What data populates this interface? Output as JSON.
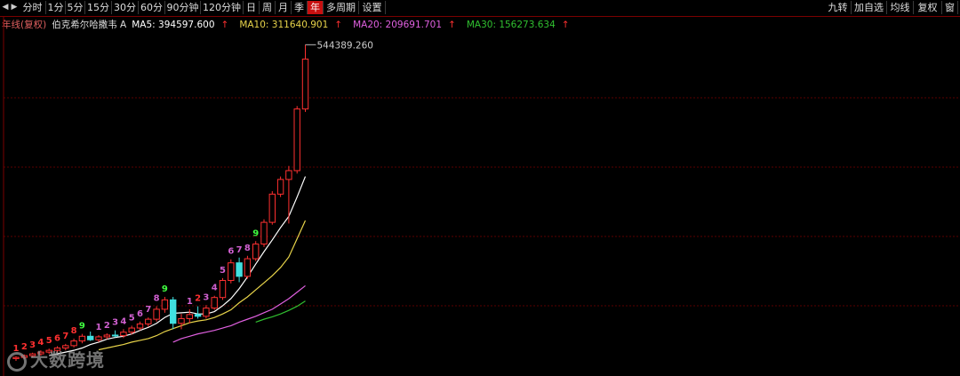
{
  "toolbar": {
    "left_items": [
      "分时",
      "1分",
      "5分",
      "15分",
      "30分",
      "60分",
      "90分钟",
      "120分钟",
      "日",
      "周",
      "月",
      "季",
      "年",
      "多周期",
      "设置"
    ],
    "active_item": "年",
    "right_items": [
      "九转",
      "加自选",
      "均线",
      "复权",
      "窗"
    ]
  },
  "legend": {
    "period": "年线(复权)",
    "name": "伯克希尔哈撒韦 A",
    "ma5": "MA5: 394597.600",
    "ma10": "MA10: 311640.901",
    "ma20": "MA20: 209691.701",
    "ma30": "MA30: 156273.634"
  },
  "price_label_high": "544389.260",
  "watermark": "大数跨境",
  "colors": {
    "up": "#ff3030",
    "down": "#40e0e0",
    "ma5": "#ffffff",
    "ma10": "#e8d44a",
    "ma20": "#e060e0",
    "ma30": "#30c030",
    "grid": "#5a0000",
    "td_purple": "#d060d0",
    "td_red": "#ff3030",
    "td_green": "#40ff40"
  },
  "chart_data": {
    "type": "candlestick",
    "ylim": [
      0,
      560000
    ],
    "candles": [
      {
        "o": 10,
        "h": 14,
        "l": 6,
        "c": 12,
        "d": "up"
      },
      {
        "o": 12,
        "h": 17,
        "l": 9,
        "c": 15,
        "d": "up"
      },
      {
        "o": 15,
        "h": 20,
        "l": 12,
        "c": 18,
        "d": "up"
      },
      {
        "o": 18,
        "h": 24,
        "l": 15,
        "c": 21,
        "d": "up"
      },
      {
        "o": 21,
        "h": 27,
        "l": 18,
        "c": 24,
        "d": "up"
      },
      {
        "o": 24,
        "h": 31,
        "l": 20,
        "c": 28,
        "d": "up"
      },
      {
        "o": 28,
        "h": 35,
        "l": 24,
        "c": 32,
        "d": "up"
      },
      {
        "o": 32,
        "h": 44,
        "l": 29,
        "c": 40,
        "d": "up"
      },
      {
        "o": 40,
        "h": 52,
        "l": 36,
        "c": 48,
        "d": "up"
      },
      {
        "o": 48,
        "h": 56,
        "l": 40,
        "c": 42,
        "d": "down"
      },
      {
        "o": 42,
        "h": 50,
        "l": 38,
        "c": 47,
        "d": "up"
      },
      {
        "o": 47,
        "h": 53,
        "l": 43,
        "c": 50,
        "d": "up"
      },
      {
        "o": 50,
        "h": 58,
        "l": 46,
        "c": 49,
        "d": "down"
      },
      {
        "o": 49,
        "h": 60,
        "l": 45,
        "c": 55,
        "d": "up"
      },
      {
        "o": 55,
        "h": 66,
        "l": 51,
        "c": 62,
        "d": "up"
      },
      {
        "o": 62,
        "h": 73,
        "l": 58,
        "c": 69,
        "d": "up"
      },
      {
        "o": 69,
        "h": 80,
        "l": 64,
        "c": 77,
        "d": "up"
      },
      {
        "o": 77,
        "h": 99,
        "l": 73,
        "c": 94,
        "d": "up"
      },
      {
        "o": 94,
        "h": 115,
        "l": 88,
        "c": 110,
        "d": "up"
      },
      {
        "o": 110,
        "h": 115,
        "l": 60,
        "c": 70,
        "d": "down"
      },
      {
        "o": 70,
        "h": 86,
        "l": 60,
        "c": 78,
        "d": "up"
      },
      {
        "o": 78,
        "h": 94,
        "l": 70,
        "c": 85,
        "d": "up"
      },
      {
        "o": 85,
        "h": 99,
        "l": 78,
        "c": 82,
        "d": "down"
      },
      {
        "o": 82,
        "h": 101,
        "l": 78,
        "c": 96,
        "d": "up"
      },
      {
        "o": 96,
        "h": 117,
        "l": 93,
        "c": 114,
        "d": "up"
      },
      {
        "o": 114,
        "h": 147,
        "l": 110,
        "c": 143,
        "d": "up"
      },
      {
        "o": 143,
        "h": 179,
        "l": 138,
        "c": 173,
        "d": "up"
      },
      {
        "o": 173,
        "h": 182,
        "l": 140,
        "c": 150,
        "d": "down"
      },
      {
        "o": 150,
        "h": 185,
        "l": 146,
        "c": 180,
        "d": "up"
      },
      {
        "o": 180,
        "h": 210,
        "l": 176,
        "c": 205,
        "d": "up"
      },
      {
        "o": 205,
        "h": 247,
        "l": 200,
        "c": 242,
        "d": "up"
      },
      {
        "o": 242,
        "h": 295,
        "l": 238,
        "c": 290,
        "d": "up"
      },
      {
        "o": 290,
        "h": 320,
        "l": 285,
        "c": 315,
        "d": "up"
      },
      {
        "o": 315,
        "h": 338,
        "l": 240,
        "c": 330,
        "d": "up"
      },
      {
        "o": 330,
        "h": 440,
        "l": 325,
        "c": 435,
        "d": "up"
      },
      {
        "o": 435,
        "h": 544.389,
        "l": 430,
        "c": 520,
        "d": "up"
      }
    ],
    "ma5": [
      null,
      null,
      null,
      null,
      15,
      18,
      21,
      24,
      28,
      34,
      38,
      43,
      46,
      48,
      52,
      58,
      63,
      70,
      80,
      87,
      88,
      89,
      86,
      86,
      90,
      100,
      112,
      129,
      149,
      171,
      192,
      212,
      233,
      252,
      285,
      320
    ],
    "ma10": [
      null,
      null,
      null,
      null,
      null,
      null,
      null,
      null,
      null,
      null,
      25,
      28,
      31,
      34,
      38,
      41,
      44,
      49,
      56,
      61,
      66,
      71,
      74,
      76,
      80,
      86,
      93,
      105,
      115,
      127,
      139,
      151,
      165,
      183,
      214,
      245
    ],
    "ma20": [
      null,
      null,
      null,
      null,
      null,
      null,
      null,
      null,
      null,
      null,
      null,
      null,
      null,
      null,
      null,
      null,
      null,
      null,
      null,
      38,
      44,
      48,
      52,
      55,
      58,
      62,
      66,
      72,
      77,
      82,
      88,
      94,
      103,
      112,
      123,
      134
    ],
    "ma30": [
      null,
      null,
      null,
      null,
      null,
      null,
      null,
      null,
      null,
      null,
      null,
      null,
      null,
      null,
      null,
      null,
      null,
      null,
      null,
      null,
      null,
      null,
      null,
      null,
      null,
      null,
      null,
      null,
      null,
      72,
      77,
      81,
      86,
      92,
      99,
      108
    ],
    "td_labels": [
      {
        "i": 0,
        "t": "1",
        "c": "red"
      },
      {
        "i": 1,
        "t": "2",
        "c": "red"
      },
      {
        "i": 2,
        "t": "3",
        "c": "red"
      },
      {
        "i": 3,
        "t": "4",
        "c": "red"
      },
      {
        "i": 4,
        "t": "5",
        "c": "red"
      },
      {
        "i": 5,
        "t": "6",
        "c": "red"
      },
      {
        "i": 6,
        "t": "7",
        "c": "red"
      },
      {
        "i": 7,
        "t": "8",
        "c": "red"
      },
      {
        "i": 8,
        "t": "9",
        "c": "green"
      },
      {
        "i": 10,
        "t": "1",
        "c": "purple"
      },
      {
        "i": 11,
        "t": "2",
        "c": "purple"
      },
      {
        "i": 12,
        "t": "3",
        "c": "purple"
      },
      {
        "i": 13,
        "t": "4",
        "c": "purple"
      },
      {
        "i": 14,
        "t": "5",
        "c": "purple"
      },
      {
        "i": 15,
        "t": "6",
        "c": "purple"
      },
      {
        "i": 16,
        "t": "7",
        "c": "purple"
      },
      {
        "i": 17,
        "t": "8",
        "c": "purple"
      },
      {
        "i": 18,
        "t": "9",
        "c": "green"
      },
      {
        "i": 21,
        "t": "1",
        "c": "purple"
      },
      {
        "i": 22,
        "t": "2",
        "c": "red"
      },
      {
        "i": 23,
        "t": "3",
        "c": "purple"
      },
      {
        "i": 24,
        "t": "4",
        "c": "purple"
      },
      {
        "i": 25,
        "t": "5",
        "c": "purple"
      },
      {
        "i": 26,
        "t": "6",
        "c": "purple"
      },
      {
        "i": 27,
        "t": "7",
        "c": "purple"
      },
      {
        "i": 28,
        "t": "8",
        "c": "purple"
      },
      {
        "i": 29,
        "t": "9",
        "c": "green"
      }
    ]
  }
}
